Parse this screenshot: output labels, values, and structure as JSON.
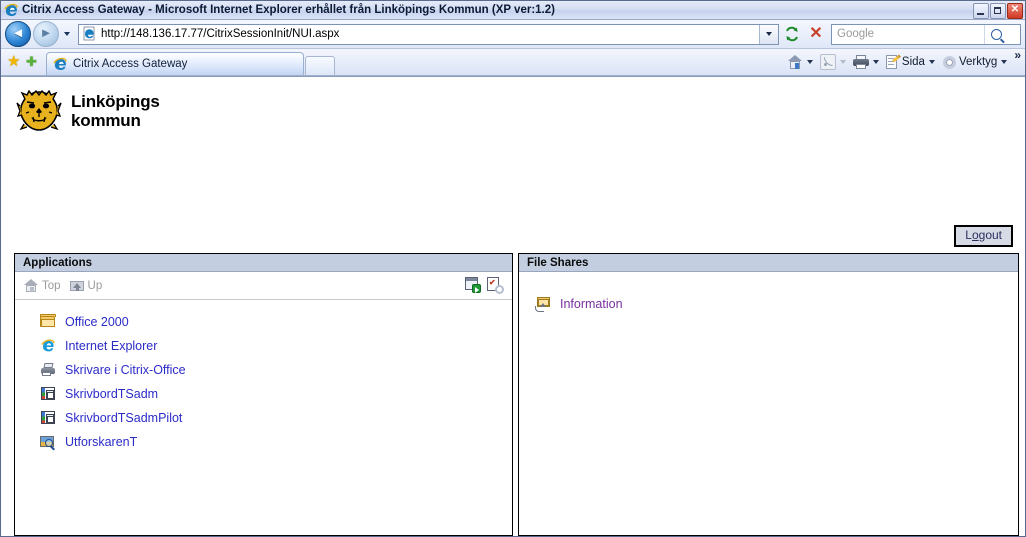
{
  "window": {
    "title": "Citrix Access Gateway - Microsoft Internet Explorer erhållet från Linköpings Kommun (XP ver:1.2)",
    "title_icon": "ie-icon",
    "minimize_label": "Minimize",
    "maximize_label": "Maximize",
    "close_label": "Close"
  },
  "browser": {
    "back_label": "Back",
    "forward_label": "Forward",
    "history_dropdown_label": "Recent Pages",
    "address": {
      "value": "http://148.136.17.77/CitrixSessionInit/NUI.aspx",
      "icon": "ie-page-icon",
      "dropdown_label": "Address history"
    },
    "refresh_label": "Refresh",
    "stop_label": "Stop",
    "search": {
      "placeholder": "Google",
      "value": "",
      "go_label": "Search",
      "provider_dropdown_label": "Search provider"
    },
    "favorites": {
      "center_label": "Favorites Center",
      "add_label": "Add to Favorites"
    },
    "tabs": [
      {
        "label": "Citrix Access Gateway",
        "icon": "ie-icon",
        "active": true
      }
    ],
    "new_tab_label": "New Tab",
    "toolbar": [
      {
        "name": "home",
        "label": "",
        "icon": "home-icon",
        "has_caret": true
      },
      {
        "name": "feeds",
        "label": "",
        "icon": "rss-icon",
        "has_caret": true,
        "disabled": true
      },
      {
        "name": "print",
        "label": "",
        "icon": "printer-icon",
        "has_caret": true
      },
      {
        "name": "page",
        "label": "Sida",
        "icon": "page-icon",
        "has_caret": true
      },
      {
        "name": "tools",
        "label": "Verktyg",
        "icon": "gear-icon",
        "has_caret": true
      }
    ],
    "overflow_label": "»"
  },
  "page": {
    "logo": {
      "icon": "lion-head-icon",
      "line1": "Linköpings",
      "line2": "kommun",
      "color": "#e8b21e"
    },
    "logout": {
      "label": "Logout",
      "accesskey_char": "o"
    },
    "applications_panel": {
      "header": "Applications",
      "nav": [
        {
          "label": "Top",
          "icon": "home-grey-icon",
          "enabled": false
        },
        {
          "label": "Up",
          "icon": "folder-up-grey-icon",
          "enabled": false
        }
      ],
      "actions": [
        {
          "name": "reconnect-icon",
          "label": "Reconnect"
        },
        {
          "name": "preferences-icon",
          "label": "Preferences"
        }
      ],
      "items": [
        {
          "label": "Office 2000",
          "icon": "folder-icon",
          "visited": false
        },
        {
          "label": "Internet Explorer",
          "icon": "ie-icon",
          "visited": false
        },
        {
          "label": "Skrivare i Citrix-Office",
          "icon": "printer-icon",
          "visited": false
        },
        {
          "label": "SkrivbordTSadm",
          "icon": "desktop-window-icon",
          "visited": false
        },
        {
          "label": "SkrivbordTSadmPilot",
          "icon": "desktop-window-icon",
          "visited": false
        },
        {
          "label": "UtforskarenT",
          "icon": "explorer-icon",
          "visited": false
        }
      ]
    },
    "file_shares_panel": {
      "header": "File Shares",
      "items": [
        {
          "label": "Information",
          "icon": "shared-folder-icon",
          "visited": true
        }
      ]
    }
  },
  "colors": {
    "panel_header_bg": "#c3cee0",
    "link": "#2b2bc8",
    "visited_link": "#7a2f9e",
    "logo_gold": "#e8b21e",
    "title_text": "#0b1a35"
  }
}
